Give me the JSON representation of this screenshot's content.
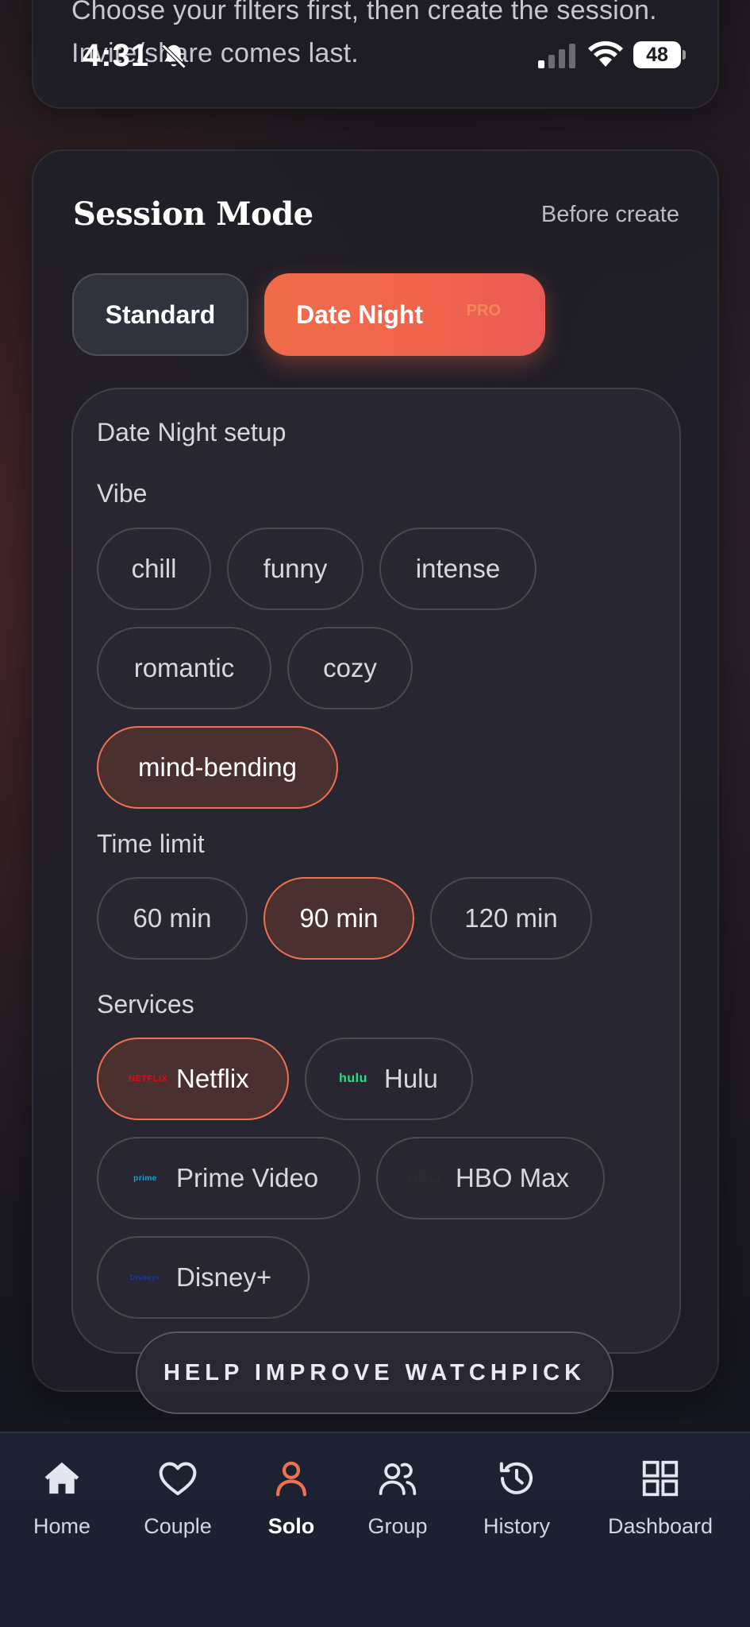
{
  "status_bar": {
    "time": "4:31",
    "battery": "48"
  },
  "intro": {
    "text": "Choose your filters first, then create the session. Invite/share comes last."
  },
  "session_mode": {
    "title": "Session Mode",
    "note": "Before create",
    "modes": [
      {
        "label": "Standard"
      },
      {
        "label": "Date Night",
        "badge": "PRO"
      }
    ],
    "selected_mode": "Date Night"
  },
  "date_night_setup": {
    "title": "Date Night setup",
    "vibe": {
      "label": "Vibe",
      "options": [
        "chill",
        "funny",
        "intense",
        "romantic",
        "cozy",
        "mind-bending"
      ],
      "selected": "mind-bending"
    },
    "time_limit": {
      "label": "Time limit",
      "options": [
        "60 min",
        "90 min",
        "120 min"
      ],
      "selected": "90 min"
    },
    "services": {
      "label": "Services",
      "options": [
        {
          "name": "Netflix",
          "logo_text": "NETFLIX",
          "logo_color": "#e50914"
        },
        {
          "name": "Hulu",
          "logo_text": "hulu",
          "logo_color": "#1ce783"
        },
        {
          "name": "Prime Video",
          "logo_text": "prime",
          "logo_color": "#00a8e1"
        },
        {
          "name": "HBO Max",
          "logo_text": "HBO",
          "logo_color": "#222222"
        },
        {
          "name": "Disney+",
          "logo_text": "Disney+",
          "logo_color": "#113ccf"
        }
      ],
      "selected": [
        "Netflix"
      ]
    }
  },
  "help_banner": {
    "label": "HELP IMPROVE WATCHPICK"
  },
  "bottom_nav": {
    "items": [
      {
        "label": "Home",
        "icon": "home-icon"
      },
      {
        "label": "Couple",
        "icon": "heart-icon"
      },
      {
        "label": "Solo",
        "icon": "person-icon"
      },
      {
        "label": "Group",
        "icon": "group-icon"
      },
      {
        "label": "History",
        "icon": "history-icon"
      },
      {
        "label": "Dashboard",
        "icon": "dashboard-icon"
      }
    ],
    "active": "Solo"
  },
  "colors": {
    "accent": "#f0714f",
    "selected_chip_bg": "#4a302e",
    "nav_bg": "#1d2233",
    "card_bg": "#201e28"
  }
}
